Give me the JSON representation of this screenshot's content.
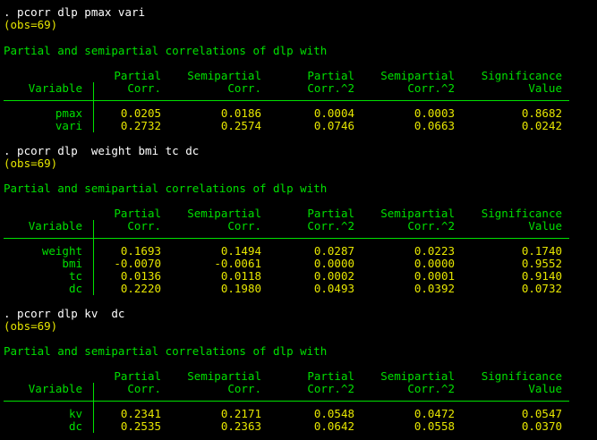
{
  "blocks": [
    {
      "command": ". pcorr dlp pmax vari",
      "obs": "(obs=69)",
      "heading": "Partial and semipartial correlations of dlp with",
      "headers": {
        "row1": [
          "",
          "Partial",
          "Semipartial",
          "Partial",
          "Semipartial",
          "Significance"
        ],
        "row2": [
          "Variable",
          "Corr.",
          "Corr.",
          "Corr.^2",
          "Corr.^2",
          "Value"
        ]
      },
      "rows": [
        [
          "pmax",
          "0.0205",
          "0.0186",
          "0.0004",
          "0.0003",
          "0.8682"
        ],
        [
          "vari",
          "0.2732",
          "0.2574",
          "0.0746",
          "0.0663",
          "0.0242"
        ]
      ]
    },
    {
      "command": ". pcorr dlp  weight bmi tc dc",
      "obs": "(obs=69)",
      "heading": "Partial and semipartial correlations of dlp with",
      "headers": {
        "row1": [
          "",
          "Partial",
          "Semipartial",
          "Partial",
          "Semipartial",
          "Significance"
        ],
        "row2": [
          "Variable",
          "Corr.",
          "Corr.",
          "Corr.^2",
          "Corr.^2",
          "Value"
        ]
      },
      "rows": [
        [
          "weight",
          "0.1693",
          "0.1494",
          "0.0287",
          "0.0223",
          "0.1740"
        ],
        [
          "bmi",
          "-0.0070",
          "-0.0061",
          "0.0000",
          "0.0000",
          "0.9552"
        ],
        [
          "tc",
          "0.0136",
          "0.0118",
          "0.0002",
          "0.0001",
          "0.9140"
        ],
        [
          "dc",
          "0.2220",
          "0.1980",
          "0.0493",
          "0.0392",
          "0.0732"
        ]
      ]
    },
    {
      "command": ". pcorr dlp kv  dc",
      "obs": "(obs=69)",
      "heading": "Partial and semipartial correlations of dlp with",
      "headers": {
        "row1": [
          "",
          "Partial",
          "Semipartial",
          "Partial",
          "Semipartial",
          "Significance"
        ],
        "row2": [
          "Variable",
          "Corr.",
          "Corr.",
          "Corr.^2",
          "Corr.^2",
          "Value"
        ]
      },
      "rows": [
        [
          "kv",
          "0.2341",
          "0.2171",
          "0.0548",
          "0.0472",
          "0.0547"
        ],
        [
          "dc",
          "0.2535",
          "0.2363",
          "0.0642",
          "0.0558",
          "0.0370"
        ]
      ]
    }
  ],
  "colors": {
    "background": "#000000",
    "command_text": "#ffffff",
    "output_text": "#00e000",
    "value_text": "#e6e600"
  }
}
